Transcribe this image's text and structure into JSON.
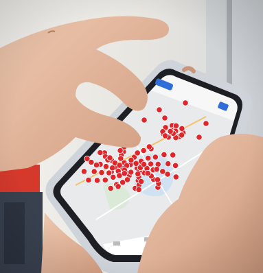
{
  "photo": {
    "subject": "",
    "colors": {
      "wall": "#e9e7e2",
      "shadow": "#b9b7b1",
      "skin": "#e3b79e",
      "skin_dark": "#c99478",
      "phone_frame": "#d9dde2",
      "screen_bezel": "#1d1f24",
      "map_land": "#e8eaec",
      "map_water": "#b9d7ef",
      "marker": "#e0262b",
      "red_box": "#d4392c",
      "blue_box": "#39414f"
    }
  },
  "phone_ui": {
    "header_title": "",
    "top_left_button": "",
    "bottom_buttons": []
  }
}
